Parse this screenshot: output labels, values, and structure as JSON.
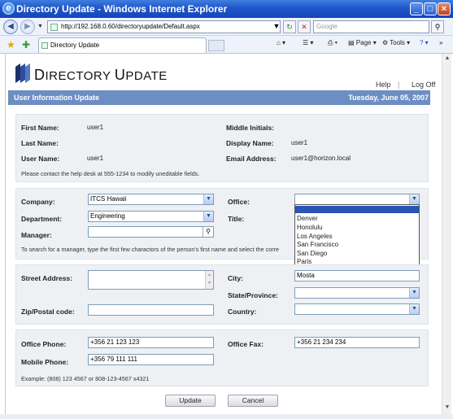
{
  "window": {
    "title": "Directory Update - Windows Internet Explorer"
  },
  "browser": {
    "address": "http://192.168.0.60/directoryupdate/Default.aspx",
    "search_placeholder": "Google",
    "tab_title": "Directory Update",
    "toolbar": {
      "page": "Page",
      "tools": "Tools"
    }
  },
  "header": {
    "logo_first": "D",
    "logo_rest": "IRECTORY",
    "logo_first2": "U",
    "logo_rest2": "PDATE",
    "help": "Help",
    "logoff": "Log Off",
    "separator": "|"
  },
  "band": {
    "title": "User Information Update",
    "date": "Tuesday, June 05, 2007"
  },
  "info": {
    "first_name_label": "First Name:",
    "first_name": "user1",
    "middle_label": "Middle Initials:",
    "middle": "",
    "last_name_label": "Last Name:",
    "last_name": "",
    "display_label": "Display Name:",
    "display": "user1",
    "username_label": "User Name:",
    "username": "user1",
    "email_label": "Email Address:",
    "email": "user1@horizon.local",
    "note": "Please contact the help desk at 555-1234 to modify uneditable fields."
  },
  "org": {
    "company_label": "Company:",
    "company": "ITCS Hawaii",
    "office_label": "Office:",
    "office": "",
    "department_label": "Department:",
    "department": "Engineering",
    "title_label": "Title:",
    "manager_label": "Manager:",
    "manager": "",
    "note": "To search for a manager, type the first few charactors of the person's first name and select the corre",
    "office_options": [
      "",
      "Denver",
      "Honolulu",
      "Los Angeles",
      "San Francisco",
      "San Diego",
      "Paris"
    ]
  },
  "address": {
    "street_label": "Street Address:",
    "street": "",
    "city_label": "City:",
    "city": "Mosta",
    "state_label": "State/Province:",
    "state": "",
    "zip_label": "Zip/Postal code:",
    "zip": "",
    "country_label": "Country:",
    "country": ""
  },
  "phones": {
    "office_label": "Office Phone:",
    "office": "+356 21 123 123",
    "fax_label": "Office Fax:",
    "fax": "+356 21 234 234",
    "mobile_label": "Mobile Phone:",
    "mobile": "+356 79 111 111",
    "example": "Example: (808) 123 4567 or 808-123-4567 x4321"
  },
  "actions": {
    "update": "Update",
    "cancel": "Cancel"
  }
}
